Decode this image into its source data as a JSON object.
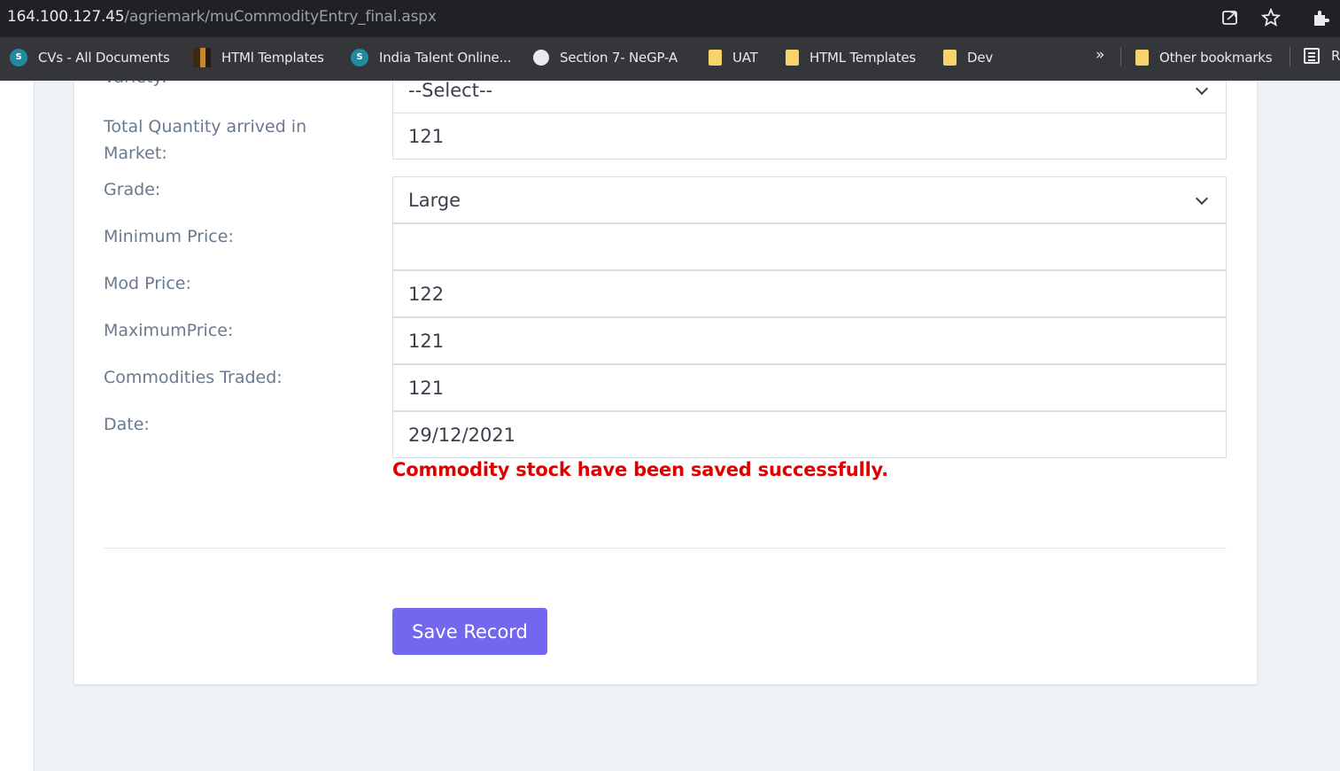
{
  "browser": {
    "url_host": "164.100.127.45",
    "url_path": "/agriemark/muCommodityEntry_final.aspx",
    "bookmarks": [
      {
        "label": "CVs - All Documents",
        "icon": "sharepoint-icon"
      },
      {
        "label": "HTMl Templates",
        "icon": "template-icon"
      },
      {
        "label": "India Talent Online...",
        "icon": "sharepoint-icon"
      },
      {
        "label": "Section 7- NeGP-A",
        "icon": "globe-icon"
      },
      {
        "label": "UAT",
        "icon": "folder-icon"
      },
      {
        "label": "HTML Templates",
        "icon": "folder-icon"
      },
      {
        "label": "Dev",
        "icon": "folder-icon"
      }
    ],
    "more_label": "»",
    "other_bookmarks": "Other bookmarks",
    "reading_list_partial": "R"
  },
  "form": {
    "variety": {
      "label": "Variety:",
      "value": "--Select--"
    },
    "total_quantity": {
      "label": "Total Quantity arrived in Market:",
      "value": "121"
    },
    "grade": {
      "label": "Grade:",
      "value": "Large"
    },
    "minimum_price": {
      "label": "Minimum Price:",
      "value": ""
    },
    "mod_price": {
      "label": "Mod Price:",
      "value": "122"
    },
    "maximum_price": {
      "label": "MaximumPrice:",
      "value": "121"
    },
    "commodities_traded": {
      "label": "Commodities Traded:",
      "value": "121"
    },
    "date": {
      "label": "Date:",
      "value": "29/12/2021"
    }
  },
  "message": "Commodity stock have been saved successfully.",
  "save_button": "Save Record",
  "colors": {
    "accent": "#7367f0",
    "error": "#e10000"
  }
}
